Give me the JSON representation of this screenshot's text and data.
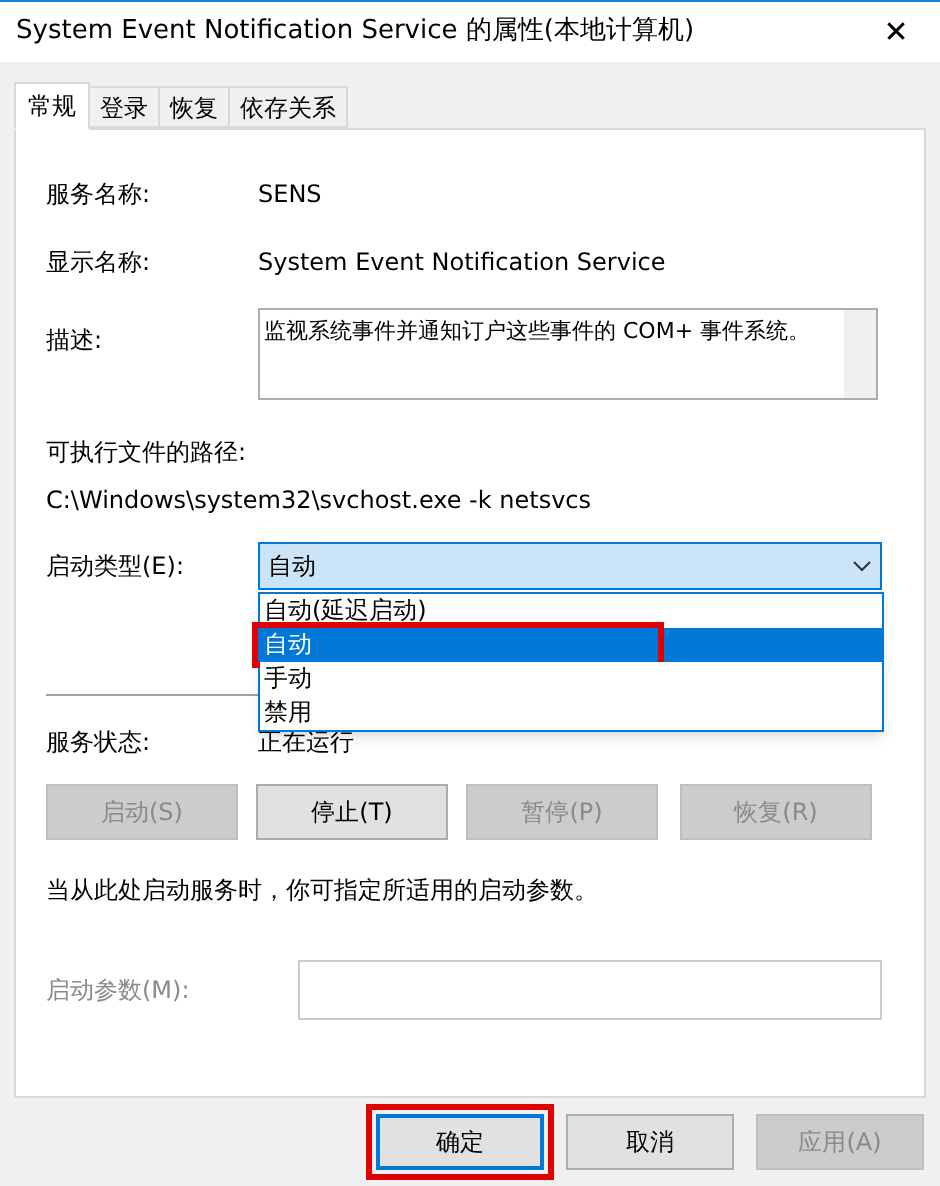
{
  "window": {
    "title": "System Event Notification Service 的属性(本地计算机)",
    "close": "✕"
  },
  "tabs": [
    {
      "label": "常规",
      "selected": true
    },
    {
      "label": "登录",
      "selected": false
    },
    {
      "label": "恢复",
      "selected": false
    },
    {
      "label": "依存关系",
      "selected": false
    }
  ],
  "fields": [
    {
      "label": "服务名称:",
      "value": "SENS"
    },
    {
      "label": "显示名称:",
      "value": "System Event Notification Service"
    }
  ],
  "description": {
    "label": "描述:",
    "value": "监视系统事件并通知订户这些事件的 COM+ 事件系统。"
  },
  "path": {
    "label": "可执行文件的路径:",
    "value": "C:\\Windows\\system32\\svchost.exe -k netsvcs"
  },
  "startup_type": {
    "label": "启动类型(E):",
    "value": "自动",
    "expanded": true,
    "options": [
      {
        "label": "自动(延迟启动)",
        "selected": false,
        "highlighted": false
      },
      {
        "label": "自动",
        "selected": true,
        "highlighted": true
      },
      {
        "label": "手动",
        "selected": false,
        "highlighted": false
      },
      {
        "label": "禁用",
        "selected": false,
        "highlighted": false
      }
    ]
  },
  "service_status": {
    "label": "服务状态:",
    "value": "正在运行"
  },
  "service_buttons": [
    {
      "label": "启动(S)",
      "disabled": true
    },
    {
      "label": "停止(T)",
      "disabled": false
    },
    {
      "label": "暂停(P)",
      "disabled": true
    },
    {
      "label": "恢复(R)",
      "disabled": true
    }
  ],
  "hint": "当从此处启动服务时，你可指定所适用的启动参数。",
  "parameters": {
    "label": "启动参数(M):",
    "disabled": true
  },
  "dialog_buttons": [
    {
      "label": "确定",
      "default": true,
      "highlighted": true,
      "disabled": false
    },
    {
      "label": "取消",
      "default": false,
      "highlighted": false,
      "disabled": false
    },
    {
      "label": "应用(A)",
      "default": false,
      "highlighted": false,
      "disabled": true
    }
  ]
}
